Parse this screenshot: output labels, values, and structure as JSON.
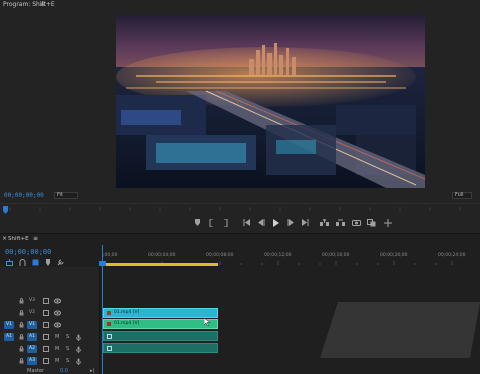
{
  "monitor": {
    "title": "Program: Shift+E",
    "timecode": "00;00;00;00",
    "fit": "Fit",
    "resolution": "Full",
    "accent": "#3b8fd8"
  },
  "transport": {
    "icons": [
      "marker-icon",
      "in-point-icon",
      "out-point-icon",
      "go-to-in-icon",
      "step-back-icon",
      "play-icon",
      "step-forward-icon",
      "go-to-out-icon",
      "lift-icon",
      "extract-icon",
      "export-frame-icon",
      "comparison-view-icon"
    ]
  },
  "timeline": {
    "title": "Shift+E",
    "timecode": "00;00;00;00",
    "ruler": [
      ";00;00",
      "00;00;04;00",
      "00;00;08;00",
      "00;00;12;00",
      "00;00;16;00",
      "00;00;20;00",
      "00;00;24;00"
    ],
    "tracks": {
      "video": [
        "V3",
        "V2",
        "V1"
      ],
      "audio": [
        "A1",
        "A2",
        "A3"
      ],
      "source_video": "V1",
      "source_audio": "A1",
      "master_label": "Master",
      "master_value": "0.0",
      "mute": "M",
      "solo": "S"
    },
    "clips": {
      "v2": "01.mp4 [V]",
      "v1": "01.mp4 [V]"
    },
    "colors": {
      "playhead": "#2a7bd3",
      "workarea": "#d6c02a",
      "clip_cyan": "#2ab6d3",
      "clip_green": "#2fbf86",
      "audio_clip": "#1b6f65"
    }
  }
}
